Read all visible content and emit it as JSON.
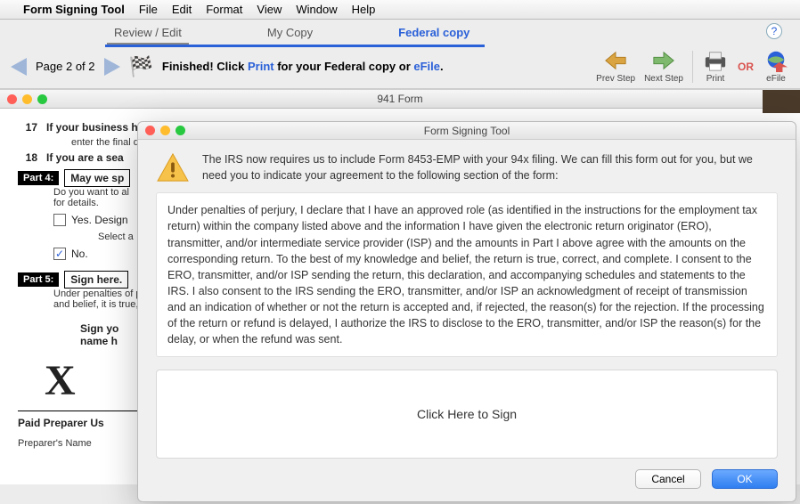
{
  "menubar": {
    "app": "Form Signing Tool",
    "items": [
      "File",
      "Edit",
      "Format",
      "View",
      "Window",
      "Help"
    ]
  },
  "tabs": {
    "items": [
      {
        "label": "Review / Edit"
      },
      {
        "label": "My Copy"
      },
      {
        "label": "Federal copy"
      }
    ],
    "active_index": 2,
    "help_glyph": "?"
  },
  "toolbar": {
    "page_text": "Page 2 of 2",
    "finished_prefix": "Finished!  Click ",
    "print_word": "Print",
    "finished_mid": " for your Federal copy or ",
    "efile_word": "eFile",
    "period": ".",
    "prev_label": "Prev Step",
    "next_label": "Next Step",
    "print_label": "Print",
    "or_label": "OR",
    "efile_label": "eFile"
  },
  "bgwindow": {
    "title": "941 Form",
    "line17_num": "17",
    "line17_text": "If your business has closed or you stopped paying wages",
    "line17_sub": "enter the final d",
    "line18_num": "18",
    "line18_text": "If you are a sea",
    "part4_label": "Part 4:",
    "part4_title": "May we sp",
    "part4_q": "Do you want to al",
    "part4_q2": "for details.",
    "yes_label": "Yes. Design",
    "select_label": "Select a",
    "no_label": "No.",
    "part5_label": "Part 5:",
    "part5_title": "Sign here.",
    "part5_p1": "Under penalties of perju",
    "part5_p2": "and belief, it is true, cor",
    "sign_instr1": "Sign yo",
    "sign_instr2": "name h",
    "paid_prep": "Paid Preparer Us",
    "prep_name": "Preparer's Name"
  },
  "modal": {
    "title": "Form Signing Tool",
    "intro": "The IRS now requires us to include Form 8453-EMP with your 94x filing. We can fill this form out for you, but we need you to indicate your agreement to the following section of the form:",
    "legal": "Under penalties of perjury, I declare that I have an approved role (as identified in the instructions for the employment tax return) within the company listed above and the information I have given the electronic return originator (ERO), transmitter, and/or intermediate service provider (ISP) and the amounts in Part I above agree with the amounts on the corresponding return. To the best of my knowledge and belief, the return is true, correct, and complete. I consent to the ERO, transmitter, and/or ISP sending the return, this declaration, and accompanying schedules and statements to the IRS. I also consent to the IRS sending the ERO, transmitter, and/or ISP an acknowledgment of receipt of transmission and an indication of whether or not the return is accepted and, if rejected, the reason(s) for the rejection. If the processing of the return or refund is delayed, I authorize the IRS to disclose to the ERO, transmitter, and/or ISP the reason(s) for the delay, or when the refund was sent.",
    "sign_cta": "Click Here to Sign",
    "cancel": "Cancel",
    "ok": "OK"
  }
}
